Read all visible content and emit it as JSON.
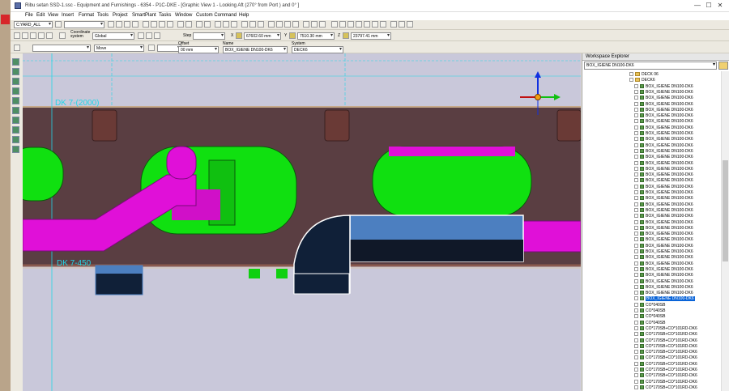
{
  "window": {
    "title": "Ribu setan SSD-1.ssc - Equipment and Furnishings - 6354 - P1C-DKE - [Graphic View 1 - Looking Aft (270° from Port ) and 0° ]",
    "controls": {
      "minimize": "—",
      "maximize": "☐",
      "close": "✕"
    }
  },
  "menu": [
    "File",
    "Edit",
    "View",
    "Insert",
    "Format",
    "Tools",
    "Project",
    "SmartPlant",
    "Tasks",
    "Window",
    "Custom Command",
    "Help"
  ],
  "toolbar1": {
    "filter_combo": "C:YARD_ALL"
  },
  "toolbar2": {
    "coord_label": "Coordinate system",
    "coord_value": "Global",
    "step_label": "Step",
    "x_label": "X",
    "x_value": "67602.60 mm",
    "y_label": "Y",
    "y_value": "7510.30 mm",
    "z_label": "Z",
    "z_value": "23797.41 mm"
  },
  "toolbar3": {
    "mode_value": "Move",
    "offset_label": "Offset",
    "offset_value": "00 mm",
    "name_label": "Name",
    "name_value": "BOX_IGIENE DN100-DK6",
    "system_label": "System",
    "system_value": "DECK6"
  },
  "viewport": {
    "label_top": "DK 7-(2000)",
    "label_bottom": "DK 7-450",
    "colors": {
      "background": "#c9c8da",
      "pink_pipe": "#e010d8",
      "green_box": "#10e010",
      "blue_duct": "#4c7fc0",
      "deck_brown": "#5a3e42"
    }
  },
  "workspace": {
    "title": "Workspace Explorer",
    "combo_value": "BOX_IGIENE DN100-DK6",
    "tree": {
      "parent_items": [
        "DECK 06",
        "DECK6"
      ],
      "box_items": [
        "BOX_IGIENE DN100-DK6",
        "BOX_IGIENE DN100-DK6",
        "BOX_IGIENE DN100-DK6",
        "BOX_IGIENE DN100-DK6",
        "BOX_IGIENE DN100-DK6",
        "BOX_IGIENE DN100-DK6",
        "BOX_IGIENE DN100-DK6",
        "BOX_IGIENE DN100-DK6",
        "BOX_IGIENE DN100-DK6",
        "BOX_IGIENE DN100-DK6",
        "BOX_IGIENE DN100-DK6",
        "BOX_IGIENE DN100-DK6",
        "BOX_IGIENE DN100-DK6",
        "BOX_IGIENE DN100-DK6",
        "BOX_IGIENE DN100-DK6",
        "BOX_IGIENE DN100-DK6",
        "BOX_IGIENE DN100-DK6",
        "BOX_IGIENE DN100-DK6",
        "BOX_IGIENE DN100-DK6",
        "BOX_IGIENE DN100-DK6",
        "BOX_IGIENE DN100-DK6",
        "BOX_IGIENE DN100-DK6",
        "BOX_IGIENE DN100-DK6",
        "BOX_IGIENE DN100-DK6",
        "BOX_IGIENE DN100-DK6",
        "BOX_IGIENE DN100-DK6",
        "BOX_IGIENE DN100-DK6",
        "BOX_IGIENE DN100-DK6",
        "BOX_IGIENE DN100-DK6",
        "BOX_IGIENE DN100-DK6",
        "BOX_IGIENE DN100-DK6",
        "BOX_IGIENE DN100-DK6",
        "BOX_IGIENE DN100-DK6",
        "BOX_IGIENE DN100-DK6",
        "BOX_IGIENE DN100-DK6",
        "BOX_IGIENE DN100-DK6",
        "BOX_IGIENE DN100-DK6"
      ],
      "selected_index": 36,
      "co_items": [
        "CO*040SB",
        "CO*040SB",
        "CO*040SB",
        "CO*040SB"
      ],
      "co2_items": [
        "CO*170SB+CO*101RD-DK6",
        "CO*170SB+CO*101RD-DK6",
        "CO*170SB+CO*101RD-DK6",
        "CO*170SB+CO*101RD-DK6",
        "CO*170SB+CO*101RD-DK6",
        "CO*170SB+CO*101RD-DK6",
        "CO*170SB+CO*101RD-DK6",
        "CO*170SB+CO*101RD-DK6",
        "CO*170SB+CO*101RD-DK6",
        "CO*170SB+CO*101RD-DK6",
        "CO*170SB+CO*101RD-DK6",
        "CO*170SB+CO*101RD-DK6"
      ]
    }
  }
}
